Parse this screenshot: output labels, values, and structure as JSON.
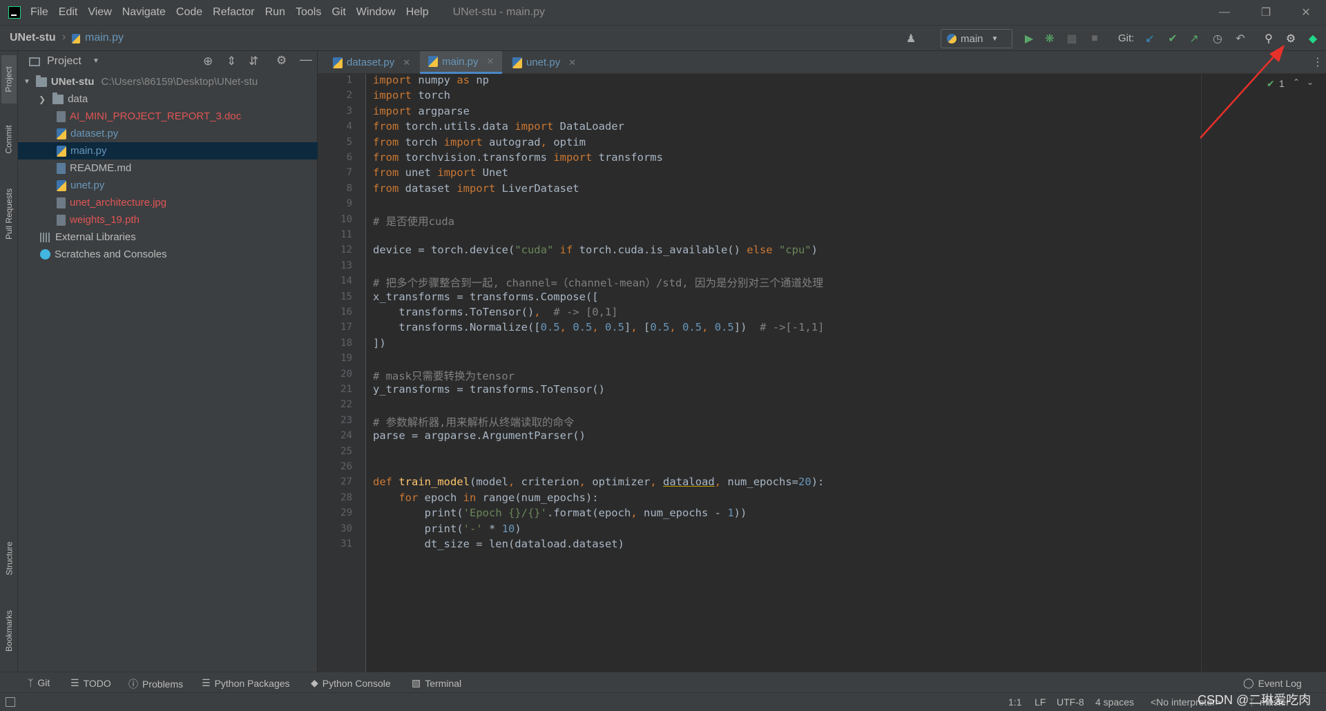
{
  "menu": [
    "File",
    "Edit",
    "View",
    "Navigate",
    "Code",
    "Refactor",
    "Run",
    "Tools",
    "Git",
    "Window",
    "Help"
  ],
  "window_title": "UNet-stu - main.py",
  "nav": {
    "project": "UNet-stu",
    "file": "main.py",
    "run_config": "main",
    "git_label": "Git:"
  },
  "project_panel": {
    "title": "Project",
    "root": {
      "name": "UNet-stu",
      "path": "C:\\Users\\86159\\Desktop\\UNet-stu"
    },
    "items": [
      {
        "label": "data",
        "type": "folder",
        "color": "#bbbbbb"
      },
      {
        "label": "AI_MINI_PROJECT_REPORT_3.doc",
        "type": "doc",
        "color": "#e05555"
      },
      {
        "label": "dataset.py",
        "type": "py",
        "color": "#6897bb"
      },
      {
        "label": "main.py",
        "type": "py",
        "color": "#6897bb"
      },
      {
        "label": "README.md",
        "type": "md",
        "color": "#bbbbbb"
      },
      {
        "label": "unet.py",
        "type": "py",
        "color": "#6897bb"
      },
      {
        "label": "unet_architecture.jpg",
        "type": "img",
        "color": "#e05555"
      },
      {
        "label": "weights_19.pth",
        "type": "file",
        "color": "#e05555"
      }
    ],
    "external": "External Libraries",
    "scratches": "Scratches and Consoles"
  },
  "left_strip": [
    "Project",
    "Commit",
    "Pull Requests",
    "Structure",
    "Bookmarks"
  ],
  "tabs": [
    {
      "label": "dataset.py",
      "active": false
    },
    {
      "label": "main.py",
      "active": true
    },
    {
      "label": "unet.py",
      "active": false
    }
  ],
  "inspection": "1",
  "code": [
    "import numpy as np",
    "import torch",
    "import argparse",
    "from torch.utils.data import DataLoader",
    "from torch import autograd, optim",
    "from torchvision.transforms import transforms",
    "from unet import Unet",
    "from dataset import LiverDataset",
    "",
    "# 是否使用cuda",
    "",
    "device = torch.device(\"cuda\" if torch.cuda.is_available() else \"cpu\")",
    "",
    "# 把多个步骤整合到一起, channel=（channel-mean）/std, 因为是分别对三个通道处理",
    "x_transforms = transforms.Compose([",
    "    transforms.ToTensor(),  # -> [0,1]",
    "    transforms.Normalize([0.5, 0.5, 0.5], [0.5, 0.5, 0.5])  # ->[-1,1]",
    "])",
    "",
    "# mask只需要转换为tensor",
    "y_transforms = transforms.ToTensor()",
    "",
    "# 参数解析器,用来解析从终端读取的命令",
    "parse = argparse.ArgumentParser()",
    "",
    "",
    "def train_model(model, criterion, optimizer, dataload, num_epochs=20):",
    "    for epoch in range(num_epochs):",
    "        print('Epoch {}/{}'.format(epoch, num_epochs - 1))",
    "        print('-' * 10)",
    "        dt_size = len(dataload.dataset)"
  ],
  "bottom_tools": [
    "Git",
    "TODO",
    "Problems",
    "Python Packages",
    "Python Console",
    "Terminal"
  ],
  "event_log": "Event Log",
  "status": {
    "position": "1:1",
    "line_sep": "LF",
    "encoding": "UTF-8",
    "indent": "4 spaces",
    "interpreter": "<No interpreter>",
    "branch": "master"
  },
  "watermark": "CSDN @二琳爱吃肉"
}
